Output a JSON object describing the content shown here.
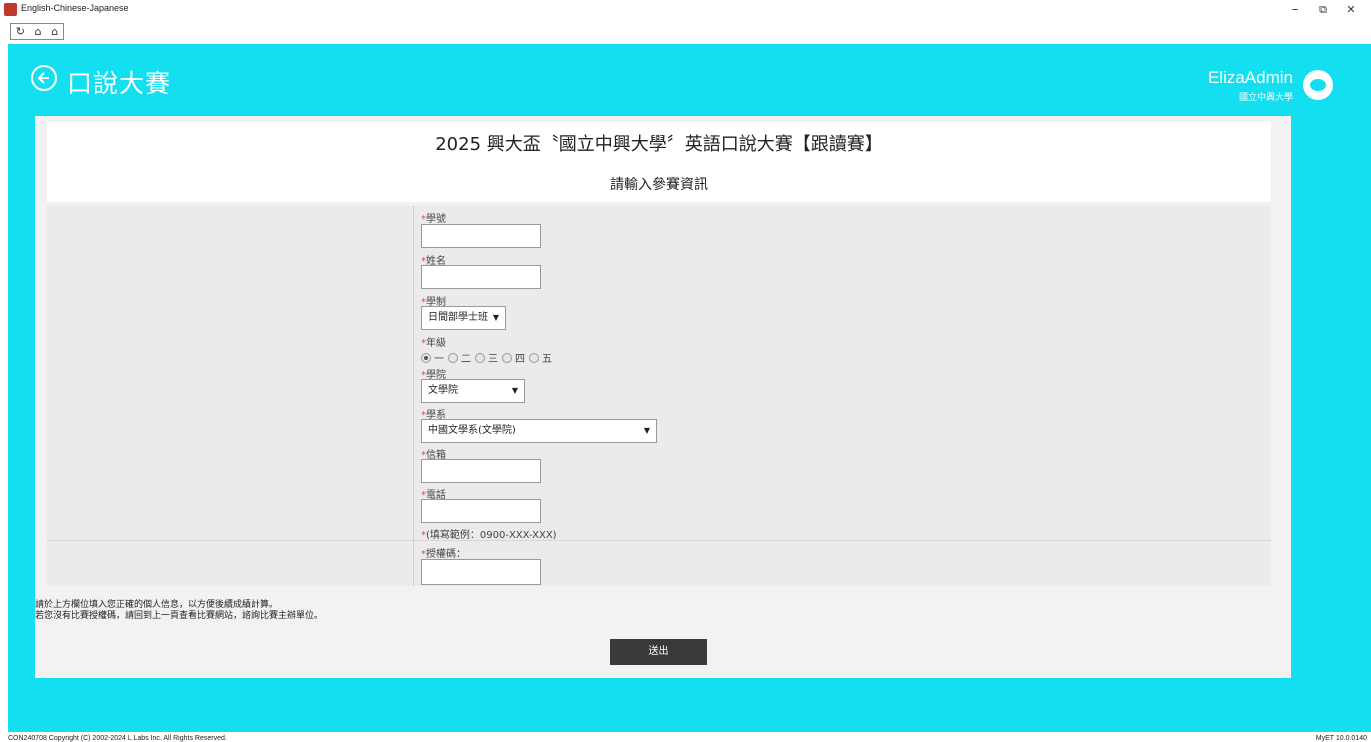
{
  "window": {
    "title": "English-Chinese-Japanese",
    "minimize": "–",
    "restore": "⧉",
    "close": "✕"
  },
  "header": {
    "title": "口說大賽",
    "user_name": "ElizaAdmin",
    "user_org": "國立中興大學"
  },
  "card": {
    "title": "2025 興大盃〝國立中興大學〞英語口說大賽【跟讀賽】",
    "subtitle": "請輸入參賽資訊"
  },
  "form": {
    "required_mark": "*",
    "student_id_label": "學號",
    "name_label": "姓名",
    "program_label": "學制",
    "program_value": "日間部學士班",
    "grade_label": "年級",
    "grades": [
      "一",
      "二",
      "三",
      "四",
      "五"
    ],
    "grade_selected": "一",
    "college_label": "學院",
    "college_value": "文學院",
    "department_label": "學系",
    "department_value": "中國文學系(文學院)",
    "email_label": "信箱",
    "phone_label": "電話",
    "phone_hint": "(填寫範例：0900-XXX-XXX)",
    "auth_label": "授權碼："
  },
  "notes": {
    "line1": "請於上方欄位填入您正確的個人信息，以方便後續成績計算。",
    "line2": "若您沒有比賽授權碼，請回到上一頁查看比賽網站，諮詢比賽主辦單位。"
  },
  "submit_label": "送出",
  "footer": {
    "left": "CON240708 Copyright (C) 2002-2024 L Labs Inc. All Rights Reserved.",
    "right": "MyET 10.0.0140"
  },
  "colors": {
    "accent": "#13dff0",
    "required": "#e74c3c",
    "button": "#3a3a3a"
  }
}
